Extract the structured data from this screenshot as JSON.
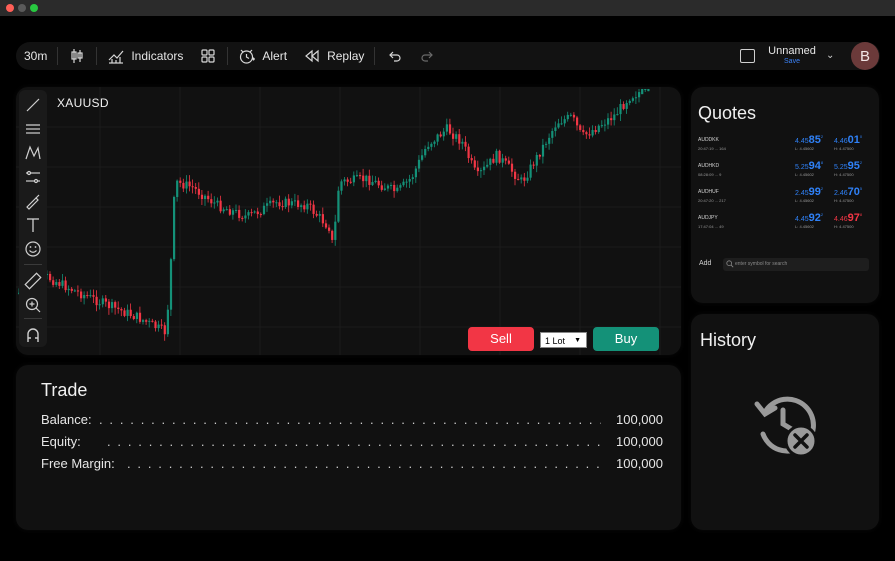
{
  "toolbar": {
    "interval": "30m",
    "indicators_label": "Indicators",
    "alert_label": "Alert",
    "replay_label": "Replay",
    "layout_name": "Unnamed",
    "save_label": "Save",
    "avatar_letter": "B"
  },
  "chart": {
    "symbol": "XAUUSD",
    "sell_label": "Sell",
    "buy_label": "Buy",
    "lot_value": "1 Lot",
    "colors": {
      "up": "#149178",
      "down": "#f23645",
      "grid": "#1c1c1c"
    }
  },
  "drawing_tools": [
    "trend-line-icon",
    "horizontal-lines-icon",
    "pattern-icon",
    "fib-icon",
    "brush-icon",
    "text-icon",
    "emoji-icon",
    "ruler-icon",
    "zoom-icon",
    "magnet-icon"
  ],
  "quotes": {
    "title": "Quotes",
    "rows": [
      {
        "symbol": "AUDDKK",
        "time": "20:47:19 ... 164",
        "bid_pre": "4.45",
        "bid_big": "85",
        "bid_sup": "2",
        "ask_pre": "4.46",
        "ask_big": "01",
        "ask_sup": "0",
        "low": "L: 4.45602",
        "high": "H: 4.47500",
        "ask_color": "blue"
      },
      {
        "symbol": "AUDHKD",
        "time": "08:28:09 ... 9",
        "bid_pre": "5.25",
        "bid_big": "94",
        "bid_sup": "8",
        "ask_pre": "5.25",
        "ask_big": "95",
        "ask_sup": "2",
        "low": "L: 4.45602",
        "high": "H: 4.47500",
        "ask_color": "blue"
      },
      {
        "symbol": "AUDHUF",
        "time": "20:47:20 ... 217",
        "bid_pre": "2.45",
        "bid_big": "99",
        "bid_sup": "2",
        "ask_pre": "2.46",
        "ask_big": "70",
        "ask_sup": "5",
        "low": "L: 4.45602",
        "high": "H: 4.47500",
        "ask_color": "blue"
      },
      {
        "symbol": "AUDJPY",
        "time": "17:47:04 ... 49",
        "bid_pre": "4.45",
        "bid_big": "92",
        "bid_sup": "2",
        "ask_pre": "4.46",
        "ask_big": "97",
        "ask_sup": "8",
        "low": "L: 4.45602",
        "high": "H: 4.47500",
        "ask_color": "red"
      }
    ],
    "add_label": "Add",
    "search_placeholder": "enter symbol for search"
  },
  "trade": {
    "title": "Trade",
    "rows": [
      {
        "label": "Balance:",
        "value": "100,000"
      },
      {
        "label": "Equity:",
        "value": "100,000"
      },
      {
        "label": "Free Margin:",
        "value": "100,000"
      }
    ]
  },
  "history": {
    "title": "History",
    "icon": "history-empty-icon"
  }
}
